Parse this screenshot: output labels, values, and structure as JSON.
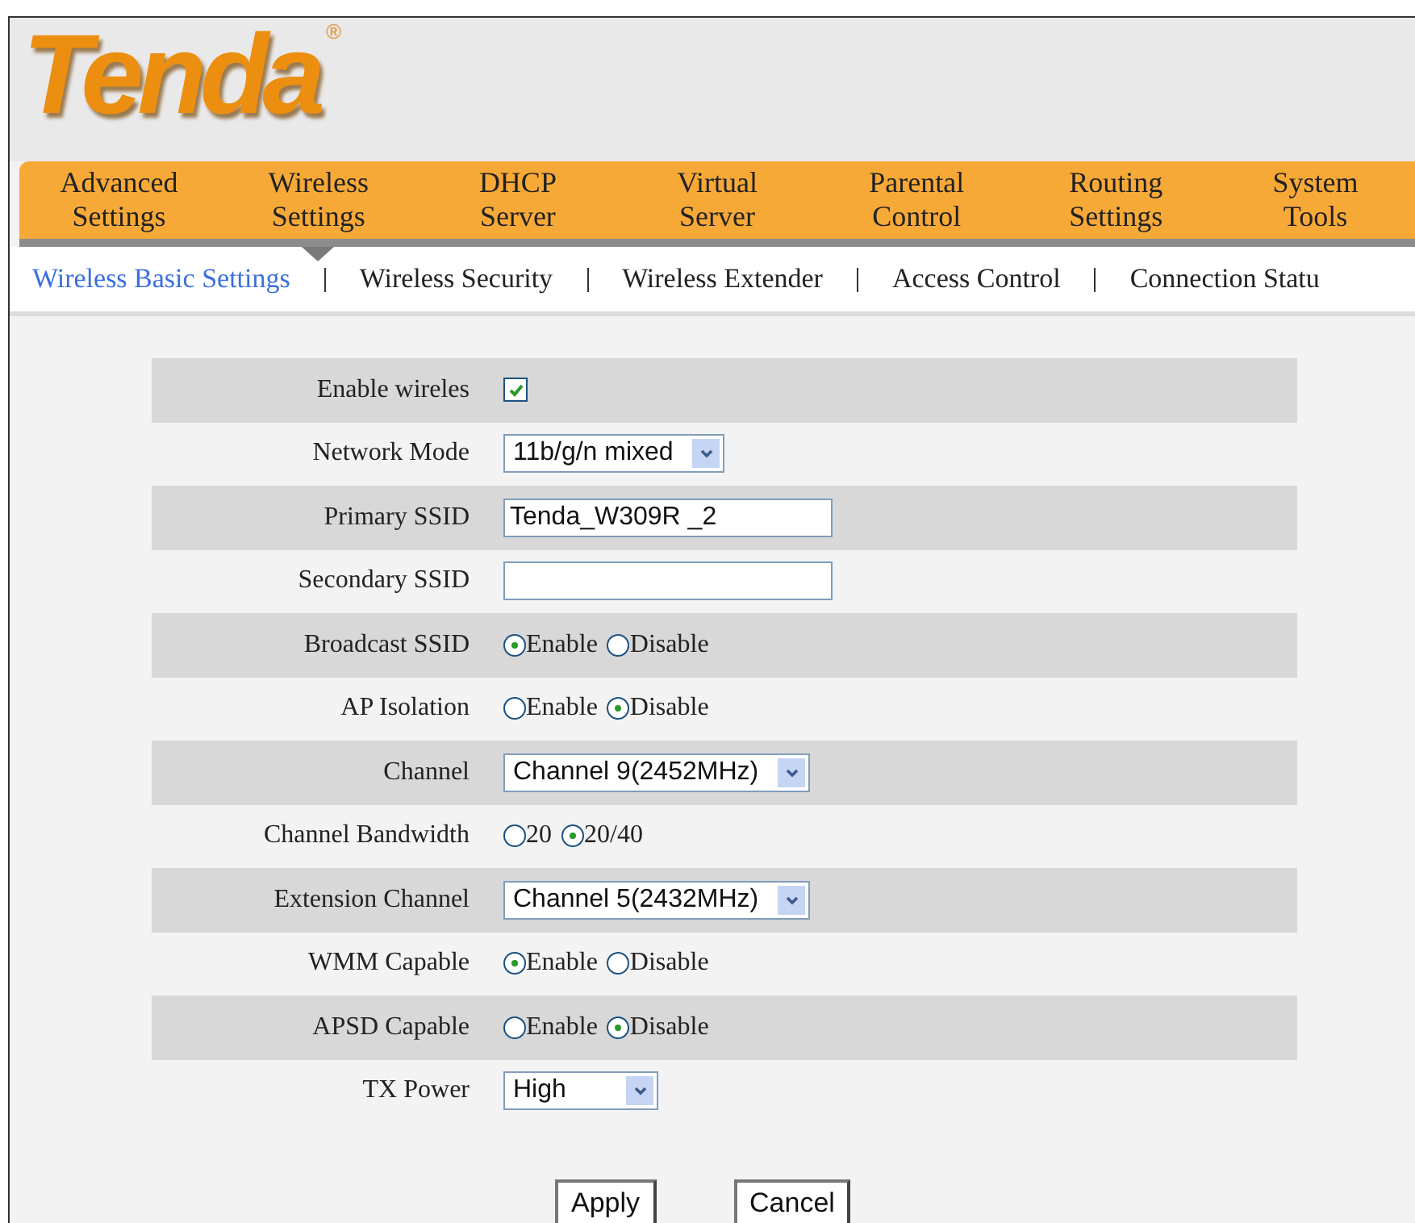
{
  "logo": {
    "text": "Tenda",
    "mark": "®"
  },
  "nav": [
    {
      "line1": "Advanced",
      "line2": "Settings",
      "selected": false
    },
    {
      "line1": "Wireless",
      "line2": "Settings",
      "selected": true
    },
    {
      "line1": "DHCP",
      "line2": "Server",
      "selected": false
    },
    {
      "line1": "Virtual",
      "line2": "Server",
      "selected": false
    },
    {
      "line1": "Parental",
      "line2": "Control",
      "selected": false
    },
    {
      "line1": "Routing",
      "line2": "Settings",
      "selected": false
    },
    {
      "line1": "System",
      "line2": "Tools",
      "selected": false
    }
  ],
  "subnav": [
    {
      "label": "Wireless Basic Settings",
      "selected": true
    },
    {
      "label": "Wireless Security",
      "selected": false
    },
    {
      "label": "Wireless Extender",
      "selected": false
    },
    {
      "label": "Access Control",
      "selected": false
    },
    {
      "label": "Connection Statu",
      "selected": false
    }
  ],
  "rows": [
    {
      "kind": "checkbox",
      "label": "Enable wireles",
      "checked": true
    },
    {
      "kind": "select",
      "label": "Network Mode",
      "value": "11b/g/n mixed"
    },
    {
      "kind": "text",
      "label": "Primary SSID",
      "value": "Tenda_W309R _2"
    },
    {
      "kind": "text",
      "label": "Secondary SSID",
      "value": ""
    },
    {
      "kind": "radio",
      "label": "Broadcast SSID",
      "options": [
        {
          "label": "Enable",
          "selected": true
        },
        {
          "label": "Disable",
          "selected": false
        }
      ]
    },
    {
      "kind": "radio",
      "label": "AP Isolation",
      "options": [
        {
          "label": "Enable",
          "selected": false
        },
        {
          "label": "Disable",
          "selected": true
        }
      ]
    },
    {
      "kind": "select",
      "label": "Channel",
      "value": "Channel 9(2452MHz)"
    },
    {
      "kind": "radio",
      "label": "Channel Bandwidth",
      "options": [
        {
          "label": "20",
          "selected": false
        },
        {
          "label": "20/40",
          "selected": true
        }
      ]
    },
    {
      "kind": "select",
      "label": "Extension Channel",
      "value": "Channel 5(2432MHz)"
    },
    {
      "kind": "radio",
      "label": "WMM Capable",
      "options": [
        {
          "label": "Enable",
          "selected": true
        },
        {
          "label": "Disable",
          "selected": false
        }
      ]
    },
    {
      "kind": "radio",
      "label": "APSD Capable",
      "options": [
        {
          "label": "Enable",
          "selected": false
        },
        {
          "label": "Disable",
          "selected": true
        }
      ]
    },
    {
      "kind": "select",
      "label": "TX Power",
      "value": "High"
    }
  ],
  "buttons": [
    "Apply",
    "Cancel"
  ]
}
